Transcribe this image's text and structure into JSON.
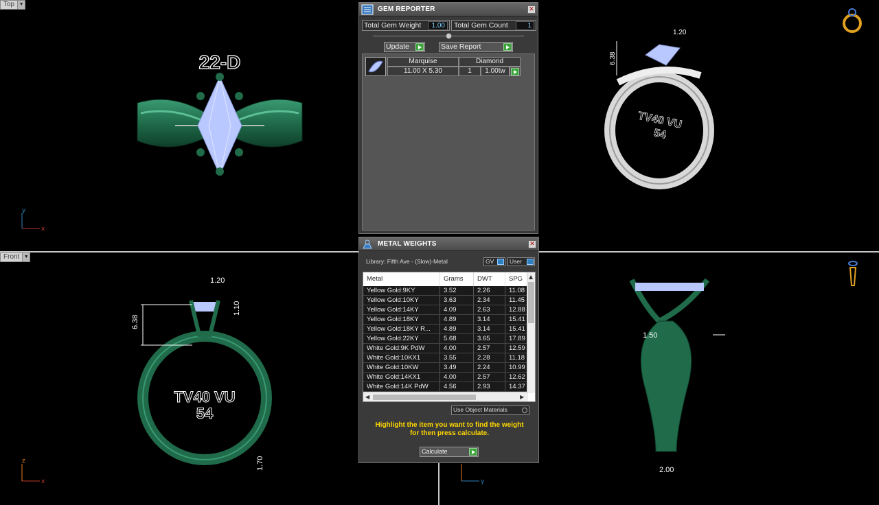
{
  "viewports": {
    "top": {
      "label": "Top",
      "text": "22-D"
    },
    "front": {
      "label": "Front",
      "engrave_line1": "TV40 VU",
      "engrave_line2": "54",
      "dims": {
        "prong": "1.20",
        "height": "6.38",
        "gap": "1.10",
        "shank": "1.70"
      }
    },
    "perspective": {
      "engrave_line1": "TV40 VU",
      "engrave_line2": "54",
      "dims": {
        "prong": "1.20",
        "height": "6.38"
      }
    },
    "right": {
      "dims": {
        "width": "1.50",
        "bottom": "2.00"
      }
    }
  },
  "gem_reporter": {
    "title": "GEM REPORTER",
    "total_weight_label": "Total Gem Weight",
    "total_weight_value": "1.00",
    "total_count_label": "Total Gem Count",
    "total_count_value": "1",
    "update_label": "Update",
    "save_report_label": "Save Report",
    "headers": {
      "shape": "Marquise",
      "type": "Diamond"
    },
    "row": {
      "size": "11.00 X 5.30",
      "qty": "1",
      "weight": "1.00tw"
    }
  },
  "metal_weights": {
    "title": "METAL WEIGHTS",
    "library": "Library: Fifth Ave - (Slow)-Metal",
    "gv_label": "GV",
    "user_label": "User",
    "columns": [
      "Metal",
      "Grams",
      "DWT",
      "SPG"
    ],
    "rows": [
      {
        "metal": "Yellow Gold:9KY",
        "grams": "3.52",
        "dwt": "2.26",
        "spg": "11.08"
      },
      {
        "metal": "Yellow Gold:10KY",
        "grams": "3.63",
        "dwt": "2.34",
        "spg": "11.45"
      },
      {
        "metal": "Yellow Gold:14KY",
        "grams": "4.09",
        "dwt": "2.63",
        "spg": "12.88"
      },
      {
        "metal": "Yellow Gold:18KY",
        "grams": "4.89",
        "dwt": "3.14",
        "spg": "15.41"
      },
      {
        "metal": "Yellow Gold:18KY R...",
        "grams": "4.89",
        "dwt": "3.14",
        "spg": "15.41"
      },
      {
        "metal": "Yellow Gold:22KY",
        "grams": "5.68",
        "dwt": "3.65",
        "spg": "17.89"
      },
      {
        "metal": "White Gold:9K PdW",
        "grams": "4.00",
        "dwt": "2.57",
        "spg": "12.59"
      },
      {
        "metal": "White Gold:10KX1",
        "grams": "3.55",
        "dwt": "2.28",
        "spg": "11.18"
      },
      {
        "metal": "White Gold:10KW",
        "grams": "3.49",
        "dwt": "2.24",
        "spg": "10.99"
      },
      {
        "metal": "White Gold:14KX1",
        "grams": "4.00",
        "dwt": "2.57",
        "spg": "12.62"
      },
      {
        "metal": "White Gold:14K PdW",
        "grams": "4.56",
        "dwt": "2.93",
        "spg": "14.37"
      }
    ],
    "use_object_materials": "Use Object Materials",
    "hint_line1": "Highlight the item you want to find the weight",
    "hint_line2": "for then press calculate.",
    "calculate_label": "Calculate"
  },
  "colors": {
    "ring": "#1f6b4a",
    "gem": "#b9c8ff",
    "hint": "#ffd800",
    "accent": "#2d7fc0"
  }
}
